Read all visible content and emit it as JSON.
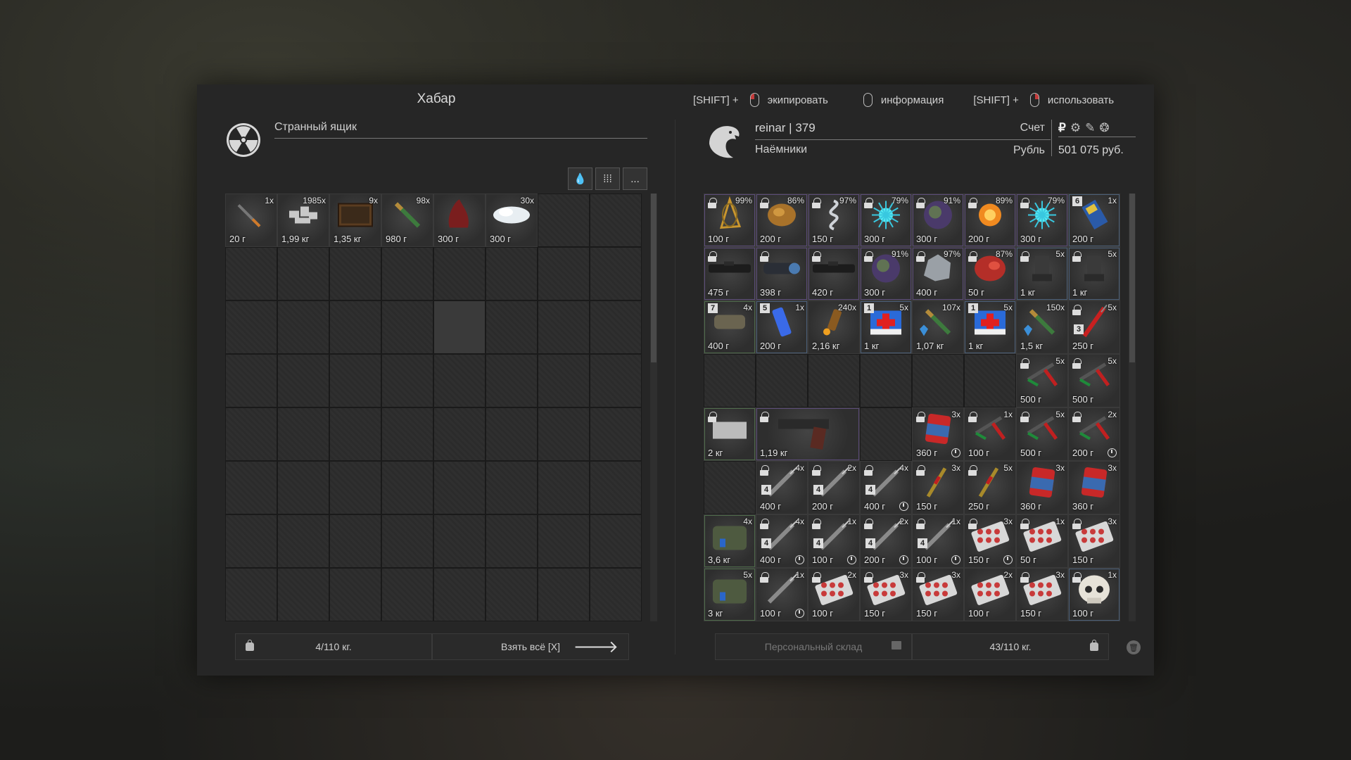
{
  "header": {
    "loot_title": "Хабар",
    "hints": [
      {
        "modifier": "[SHIFT] +",
        "mouse": "left",
        "label": "экипировать"
      },
      {
        "modifier": "",
        "mouse": "plain",
        "label": "информация"
      },
      {
        "modifier": "[SHIFT] +",
        "mouse": "right",
        "label": "использовать"
      }
    ]
  },
  "loot": {
    "container_name": "Странный ящик",
    "filters": [
      "💧",
      "⁞⁞⁞",
      "..."
    ],
    "items": [
      {
        "qty": "1x",
        "weight": "20 г",
        "art": "cig"
      },
      {
        "qty": "1985x",
        "weight": "1,99 кг",
        "art": "scrap"
      },
      {
        "qty": "9x",
        "weight": "1,35 кг",
        "art": "book"
      },
      {
        "qty": "98x",
        "weight": "980 г",
        "art": "ammo"
      },
      {
        "qty": "",
        "weight": "300 г",
        "art": "flesh"
      },
      {
        "qty": "30x",
        "weight": "300 г",
        "art": "cotton"
      }
    ],
    "footer": {
      "weight": "4/110 кг.",
      "take_all": "Взять всё [X]",
      "arrow": "🡒"
    }
  },
  "player": {
    "name": "reinar | 379",
    "faction": "Наёмники",
    "account_label": "Счет",
    "currency_label": "Рубль",
    "currency_icons": [
      "₽",
      "⚙",
      "✎",
      "❂"
    ],
    "balance": "501 075 руб.",
    "items": [
      {
        "row": 0,
        "col": 0,
        "w": 1,
        "h": 1,
        "qty": "99%",
        "weight": "100 г",
        "lock": true,
        "art": "art_cage",
        "glow": "purple"
      },
      {
        "row": 0,
        "col": 1,
        "w": 1,
        "h": 1,
        "qty": "86%",
        "weight": "200 г",
        "lock": true,
        "art": "art_crystal",
        "glow": "purple"
      },
      {
        "row": 0,
        "col": 2,
        "w": 1,
        "h": 1,
        "qty": "97%",
        "weight": "150 г",
        "lock": true,
        "art": "art_spiral",
        "glow": "purple"
      },
      {
        "row": 0,
        "col": 3,
        "w": 1,
        "h": 1,
        "qty": "79%",
        "weight": "300 г",
        "lock": true,
        "art": "art_spark",
        "glow": "purple"
      },
      {
        "row": 0,
        "col": 4,
        "w": 1,
        "h": 1,
        "qty": "91%",
        "weight": "300 г",
        "lock": true,
        "art": "art_orb",
        "glow": "purple"
      },
      {
        "row": 0,
        "col": 5,
        "w": 1,
        "h": 1,
        "qty": "89%",
        "weight": "200 г",
        "lock": true,
        "art": "art_fire",
        "glow": "purple"
      },
      {
        "row": 0,
        "col": 6,
        "w": 1,
        "h": 1,
        "qty": "79%",
        "weight": "300 г",
        "lock": true,
        "art": "art_spark",
        "glow": "purple"
      },
      {
        "row": 0,
        "col": 7,
        "w": 1,
        "h": 1,
        "qty": "1x",
        "weight": "200 г",
        "badge": "6",
        "art": "device",
        "glow": "blue"
      },
      {
        "row": 1,
        "col": 0,
        "w": 1,
        "h": 1,
        "qty": "",
        "weight": "475 г",
        "lock": true,
        "art": "scope",
        "glow": "purple"
      },
      {
        "row": 1,
        "col": 1,
        "w": 1,
        "h": 1,
        "qty": "",
        "weight": "398 г",
        "lock": true,
        "art": "scope2",
        "glow": "purple"
      },
      {
        "row": 1,
        "col": 2,
        "w": 1,
        "h": 1,
        "qty": "",
        "weight": "420 г",
        "lock": true,
        "art": "scope",
        "glow": "purple"
      },
      {
        "row": 1,
        "col": 3,
        "w": 1,
        "h": 1,
        "qty": "91%",
        "weight": "300 г",
        "lock": true,
        "art": "art_orb",
        "glow": "purple"
      },
      {
        "row": 1,
        "col": 4,
        "w": 1,
        "h": 1,
        "qty": "97%",
        "weight": "400 г",
        "lock": true,
        "art": "art_rock",
        "glow": "purple"
      },
      {
        "row": 1,
        "col": 5,
        "w": 1,
        "h": 1,
        "qty": "87%",
        "weight": "50 г",
        "lock": true,
        "art": "art_flesh",
        "glow": "purple"
      },
      {
        "row": 1,
        "col": 6,
        "w": 1,
        "h": 1,
        "qty": "5x",
        "weight": "1 кг",
        "lock": true,
        "art": "detector",
        "glow": "blue"
      },
      {
        "row": 1,
        "col": 7,
        "w": 1,
        "h": 1,
        "qty": "5x",
        "weight": "1 кг",
        "lock": true,
        "art": "detector",
        "glow": "blue"
      },
      {
        "row": 2,
        "col": 0,
        "w": 1,
        "h": 1,
        "qty": "4x",
        "weight": "400 г",
        "badge": "7",
        "art": "bandage",
        "glow": "green"
      },
      {
        "row": 2,
        "col": 1,
        "w": 1,
        "h": 1,
        "qty": "1x",
        "weight": "200 г",
        "badge": "5",
        "art": "battery",
        "glow": "blue"
      },
      {
        "row": 2,
        "col": 2,
        "w": 1,
        "h": 1,
        "qty": "240x",
        "weight": "2,16 кг",
        "art": "ammo_shot",
        "glow": "none"
      },
      {
        "row": 2,
        "col": 3,
        "w": 1,
        "h": 1,
        "qty": "5x",
        "weight": "1 кг",
        "badge": "1",
        "art": "medkit",
        "glow": "blue"
      },
      {
        "row": 2,
        "col": 4,
        "w": 1,
        "h": 1,
        "qty": "107x",
        "weight": "1,07 кг",
        "art": "ammo_green",
        "glow": "none"
      },
      {
        "row": 2,
        "col": 5,
        "w": 1,
        "h": 1,
        "qty": "5x",
        "weight": "1 кг",
        "badge": "1",
        "art": "medkit",
        "glow": "blue"
      },
      {
        "row": 2,
        "col": 6,
        "w": 1,
        "h": 1,
        "qty": "150x",
        "weight": "1,5 кг",
        "art": "ammo_green",
        "glow": "none"
      },
      {
        "row": 2,
        "col": 7,
        "w": 1,
        "h": 1,
        "qty": "5x",
        "weight": "250 г",
        "lock": true,
        "badge2": "3",
        "art": "syringe_red",
        "glow": "none"
      },
      {
        "row": 3,
        "col": 6,
        "w": 1,
        "h": 1,
        "qty": "5x",
        "weight": "500 г",
        "lock": true,
        "art": "syringe_gun",
        "glow": "none"
      },
      {
        "row": 3,
        "col": 7,
        "w": 1,
        "h": 1,
        "qty": "5x",
        "weight": "500 г",
        "lock": true,
        "art": "syringe_gun",
        "glow": "none"
      },
      {
        "row": 4,
        "col": 0,
        "w": 1,
        "h": 1,
        "qty": "",
        "weight": "2 кг",
        "lock": true,
        "art": "plate",
        "glow": "green"
      },
      {
        "row": 4,
        "col": 1,
        "w": 2,
        "h": 1,
        "qty": "",
        "weight": "1,19 кг",
        "lock": true,
        "art": "pistol",
        "glow": "purple"
      },
      {
        "row": 4,
        "col": 4,
        "w": 1,
        "h": 1,
        "qty": "3x",
        "weight": "360 г",
        "lock": true,
        "timer": true,
        "art": "can",
        "glow": "none"
      },
      {
        "row": 4,
        "col": 5,
        "w": 1,
        "h": 1,
        "qty": "1x",
        "weight": "100 г",
        "lock": true,
        "art": "syringe_gun",
        "glow": "none"
      },
      {
        "row": 4,
        "col": 6,
        "w": 1,
        "h": 1,
        "qty": "5x",
        "weight": "500 г",
        "lock": true,
        "art": "syringe_gun",
        "glow": "none"
      },
      {
        "row": 4,
        "col": 7,
        "w": 1,
        "h": 1,
        "qty": "2x",
        "weight": "200 г",
        "lock": true,
        "timer": true,
        "art": "syringe_gun",
        "glow": "none"
      },
      {
        "row": 5,
        "col": 1,
        "w": 1,
        "h": 1,
        "qty": "4x",
        "weight": "400 г",
        "lock": true,
        "badge2": "4",
        "art": "syringe",
        "glow": "none"
      },
      {
        "row": 5,
        "col": 2,
        "w": 1,
        "h": 1,
        "qty": "2x",
        "weight": "200 г",
        "lock": true,
        "badge2": "4",
        "art": "syringe",
        "glow": "none"
      },
      {
        "row": 5,
        "col": 3,
        "w": 1,
        "h": 1,
        "qty": "4x",
        "weight": "400 г",
        "lock": true,
        "badge2": "4",
        "timer": true,
        "art": "syringe",
        "glow": "none"
      },
      {
        "row": 5,
        "col": 4,
        "w": 1,
        "h": 1,
        "qty": "3x",
        "weight": "150 г",
        "lock": true,
        "art": "pen_yellow",
        "glow": "none"
      },
      {
        "row": 5,
        "col": 5,
        "w": 1,
        "h": 1,
        "qty": "5x",
        "weight": "250 г",
        "lock": true,
        "art": "pen_yellow",
        "glow": "none"
      },
      {
        "row": 5,
        "col": 6,
        "w": 1,
        "h": 1,
        "qty": "3x",
        "weight": "360 г",
        "art": "can",
        "glow": "none"
      },
      {
        "row": 5,
        "col": 7,
        "w": 1,
        "h": 1,
        "qty": "3x",
        "weight": "360 г",
        "art": "can",
        "glow": "none"
      },
      {
        "row": 6,
        "col": 0,
        "w": 1,
        "h": 1,
        "qty": "4x",
        "weight": "3,6 кг",
        "art": "bag",
        "glow": "green"
      },
      {
        "row": 6,
        "col": 1,
        "w": 1,
        "h": 1,
        "qty": "4x",
        "weight": "400 г",
        "lock": true,
        "badge2": "4",
        "timer": true,
        "art": "syringe",
        "glow": "none"
      },
      {
        "row": 6,
        "col": 2,
        "w": 1,
        "h": 1,
        "qty": "1x",
        "weight": "100 г",
        "lock": true,
        "badge2": "4",
        "timer": true,
        "art": "syringe",
        "glow": "none"
      },
      {
        "row": 6,
        "col": 3,
        "w": 1,
        "h": 1,
        "qty": "2x",
        "weight": "200 г",
        "lock": true,
        "badge2": "4",
        "timer": true,
        "art": "syringe",
        "glow": "none"
      },
      {
        "row": 6,
        "col": 4,
        "w": 1,
        "h": 1,
        "qty": "1x",
        "weight": "100 г",
        "lock": true,
        "badge2": "4",
        "timer": true,
        "art": "syringe",
        "glow": "none"
      },
      {
        "row": 6,
        "col": 5,
        "w": 1,
        "h": 1,
        "qty": "3x",
        "weight": "150 г",
        "lock": true,
        "timer": true,
        "art": "pills",
        "glow": "none"
      },
      {
        "row": 6,
        "col": 6,
        "w": 1,
        "h": 1,
        "qty": "1x",
        "weight": "50 г",
        "lock": true,
        "art": "pills",
        "glow": "none"
      },
      {
        "row": 6,
        "col": 7,
        "w": 1,
        "h": 1,
        "qty": "3x",
        "weight": "150 г",
        "lock": true,
        "art": "pills",
        "glow": "none"
      },
      {
        "row": 7,
        "col": 0,
        "w": 1,
        "h": 1,
        "qty": "5x",
        "weight": "3 кг",
        "art": "bag",
        "glow": "green"
      },
      {
        "row": 7,
        "col": 1,
        "w": 1,
        "h": 1,
        "qty": "1x",
        "weight": "100 г",
        "lock": true,
        "timer": true,
        "art": "syringe",
        "glow": "none"
      },
      {
        "row": 7,
        "col": 2,
        "w": 1,
        "h": 1,
        "qty": "2x",
        "weight": "100 г",
        "lock": true,
        "art": "pills",
        "glow": "none"
      },
      {
        "row": 7,
        "col": 3,
        "w": 1,
        "h": 1,
        "qty": "3x",
        "weight": "150 г",
        "lock": true,
        "art": "pills",
        "glow": "none"
      },
      {
        "row": 7,
        "col": 4,
        "w": 1,
        "h": 1,
        "qty": "3x",
        "weight": "150 г",
        "lock": true,
        "art": "pills",
        "glow": "none"
      },
      {
        "row": 7,
        "col": 5,
        "w": 1,
        "h": 1,
        "qty": "2x",
        "weight": "100 г",
        "art": "pills",
        "glow": "none"
      },
      {
        "row": 7,
        "col": 6,
        "w": 1,
        "h": 1,
        "qty": "3x",
        "weight": "150 г",
        "lock": true,
        "art": "pills",
        "glow": "none"
      },
      {
        "row": 7,
        "col": 7,
        "w": 1,
        "h": 1,
        "qty": "1x",
        "weight": "100 г",
        "lock": true,
        "art": "skull",
        "glow": "blue"
      }
    ],
    "footer": {
      "stash": "Персональный склад",
      "weight": "43/110 кг."
    }
  },
  "colors": {
    "lock": "#dddddd",
    "glow_purple": "#5b4b78",
    "glow_green": "#4e6a4a",
    "glow_blue": "#4b5f78",
    "text": "#cfcfcf"
  }
}
